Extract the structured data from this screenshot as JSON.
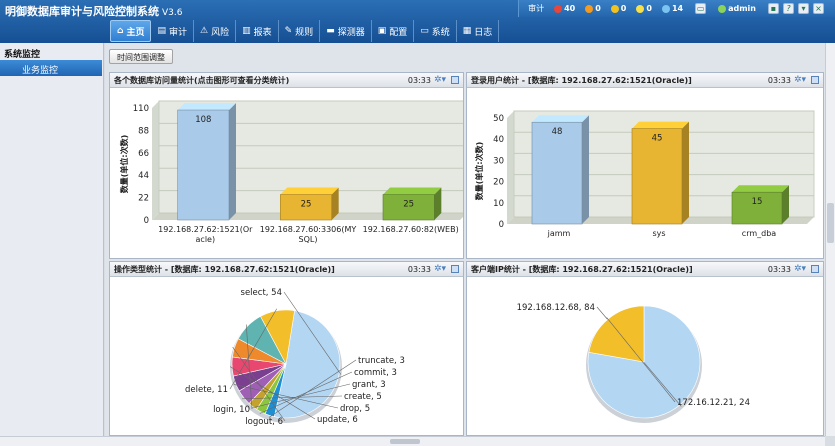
{
  "app": {
    "title": "明御数据库审计与风险控制系统",
    "version": "V3.6"
  },
  "status": {
    "alert_label": "审计",
    "c1": "40",
    "c2": "0",
    "c3": "0",
    "c4": "0",
    "c5": "14",
    "user": "admin"
  },
  "nav": [
    {
      "label": "主页",
      "icon": "home-icon"
    },
    {
      "label": "审计",
      "icon": "audit-icon"
    },
    {
      "label": "风险",
      "icon": "warning-icon"
    },
    {
      "label": "报表",
      "icon": "report-icon"
    },
    {
      "label": "规则",
      "icon": "rule-icon"
    },
    {
      "label": "探测器",
      "icon": "probe-icon"
    },
    {
      "label": "配置",
      "icon": "config-icon"
    },
    {
      "label": "系统",
      "icon": "system-icon"
    },
    {
      "label": "日志",
      "icon": "log-icon"
    }
  ],
  "sidebar": {
    "header": "系统监控",
    "item": "业务监控"
  },
  "toolbar": {
    "time_range_button": "时间范围调整"
  },
  "panels": {
    "p1": {
      "title": "各个数据库访问量统计(点击图形可查看分类统计)",
      "time": "03:33"
    },
    "p2": {
      "title": "登录用户统计 - [数据库: 192.168.27.62:1521(Oracle)]",
      "time": "03:33"
    },
    "p3": {
      "title": "操作类型统计 - [数据库: 192.168.27.62:1521(Oracle)]",
      "time": "03:33"
    },
    "p4": {
      "title": "客户端IP统计 - [数据库: 192.168.27.62:1521(Oracle)]",
      "time": "03:33"
    }
  },
  "chart_data": [
    {
      "type": "bar",
      "ylabel": "数量(单位:次数)",
      "ylim": [
        0,
        110
      ],
      "yticks": [
        0,
        22,
        44,
        66,
        88,
        110
      ],
      "categories": [
        [
          "192.168.27.62:1521(Or",
          "acle)"
        ],
        [
          "192.168.27.60:3306(MY",
          "SQL)"
        ],
        [
          "192.168.27.60:82(WEB)"
        ]
      ],
      "values": [
        108,
        25,
        25
      ],
      "colors": [
        "#a9cbe9",
        "#e7b531",
        "#7fb13a"
      ]
    },
    {
      "type": "bar",
      "ylabel": "数量(单位:次数)",
      "ylim": [
        0,
        50
      ],
      "yticks": [
        0,
        10,
        20,
        30,
        40,
        50
      ],
      "categories": [
        [
          "jamm"
        ],
        [
          "sys"
        ],
        [
          "crm_dba"
        ]
      ],
      "values": [
        48,
        45,
        15
      ],
      "colors": [
        "#a9cbe9",
        "#e7b531",
        "#7fb13a"
      ]
    },
    {
      "type": "pie",
      "slices": [
        {
          "label": "select",
          "value": 54,
          "color": "#b3d6f3"
        },
        {
          "label": "truncate",
          "value": 3,
          "color": "#1f8fd3"
        },
        {
          "label": "commit",
          "value": 3,
          "color": "#8cc63f"
        },
        {
          "label": "grant",
          "value": 3,
          "color": "#c3a32c"
        },
        {
          "label": "create",
          "value": 5,
          "color": "#9f5fb5"
        },
        {
          "label": "drop",
          "value": 5,
          "color": "#7b3f8f"
        },
        {
          "label": "update",
          "value": 6,
          "color": "#e8486f"
        },
        {
          "label": "logout",
          "value": 6,
          "color": "#ee8a2c"
        },
        {
          "label": "login",
          "value": 10,
          "color": "#5fb3b0"
        },
        {
          "label": "delete",
          "value": 11,
          "color": "#f2be2a"
        }
      ]
    },
    {
      "type": "pie",
      "slices": [
        {
          "label": "192.168.12.68",
          "value": 84,
          "color": "#b3d6f3"
        },
        {
          "label": "172.16.12.21",
          "value": 24,
          "color": "#f2be2a"
        }
      ]
    }
  ]
}
